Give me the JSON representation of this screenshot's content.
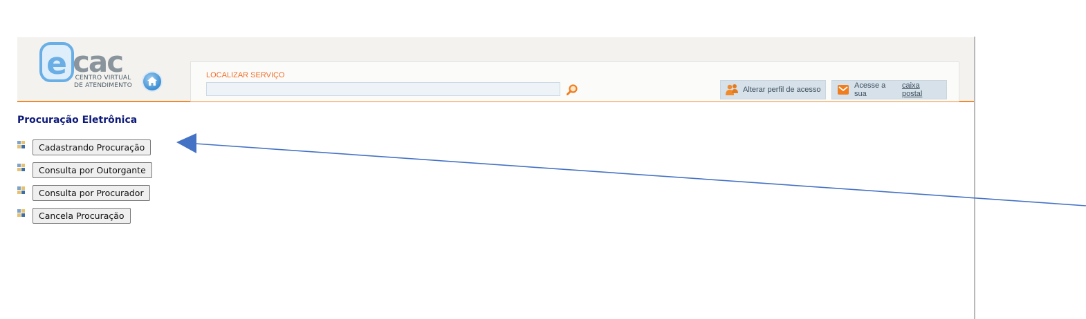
{
  "header": {
    "logo_text": "cac",
    "logo_letter": "e",
    "logo_sub_line1": "CENTRO VIRTUAL",
    "logo_sub_line2": "DE ATENDIMENTO",
    "search": {
      "label": "LOCALIZAR SERVIÇO",
      "value": "",
      "placeholder": ""
    },
    "perfil_button": "Alterar perfil de acesso",
    "caixa_prefix": "Acesse a sua",
    "caixa_link": "caixa postal"
  },
  "page": {
    "title": "Procuração Eletrônica"
  },
  "menu": [
    {
      "label": "Cadastrando Procuração"
    },
    {
      "label": "Consulta por Outorgante"
    },
    {
      "label": "Consulta por Procurador"
    },
    {
      "label": "Cancela Procuração"
    }
  ],
  "icons": {
    "home": "home-icon",
    "search": "search-icon",
    "perfil": "users-icon",
    "caixa": "mail-icon",
    "bullet": "bullet-icon"
  },
  "colors": {
    "accent": "#f08a2b",
    "title": "#0d1a7a",
    "annotation_arrow": "#4472c4"
  }
}
